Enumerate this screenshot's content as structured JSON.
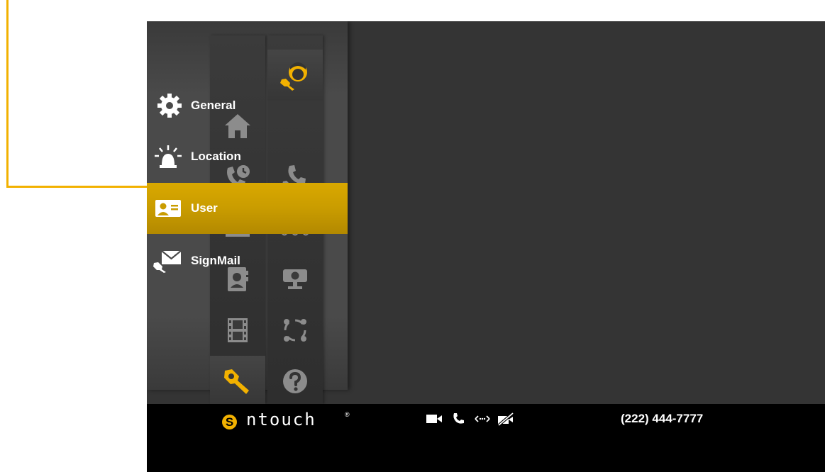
{
  "annotation": {
    "color": "#f2b100"
  },
  "nav_primary": [
    {
      "icon": "home-icon",
      "active": false
    },
    {
      "icon": "call-history-icon",
      "active": false
    },
    {
      "icon": "signmail-envelope-icon",
      "active": false
    },
    {
      "icon": "contacts-book-icon",
      "active": false
    },
    {
      "icon": "video-film-icon",
      "active": false
    },
    {
      "icon": "wrench-settings-icon",
      "active": true
    }
  ],
  "nav_secondary": [
    {
      "icon": "user-settings-icon",
      "active": true
    },
    {
      "icon": "call-settings-icon",
      "active": false
    },
    {
      "icon": "network-icon",
      "active": false
    },
    {
      "icon": "camera-icon",
      "active": false
    },
    {
      "icon": "connection-ring-icon",
      "active": false
    },
    {
      "icon": "help-icon",
      "active": false
    }
  ],
  "settings_menu": {
    "items": [
      {
        "label": "General",
        "icon": "gear-icon",
        "selected": false
      },
      {
        "label": "Location",
        "icon": "alarm-beacon-icon",
        "selected": false
      },
      {
        "label": "User",
        "icon": "user-card-icon",
        "selected": true
      },
      {
        "label": "SignMail",
        "icon": "signmail-wrench-icon",
        "selected": false
      }
    ]
  },
  "status_bar": {
    "logo_letter": "S",
    "brand": "ntouch",
    "brand_mark": "®",
    "icons": [
      "video-camera-icon",
      "phone-icon",
      "connection-arrows-icon",
      "video-privacy-off-icon"
    ],
    "phone_number": "(222) 444-7777"
  },
  "colors": {
    "accent": "#f2b100",
    "selected_bg": "#c99c00",
    "icon_gray": "#8c8c8c",
    "background": "#343434"
  }
}
